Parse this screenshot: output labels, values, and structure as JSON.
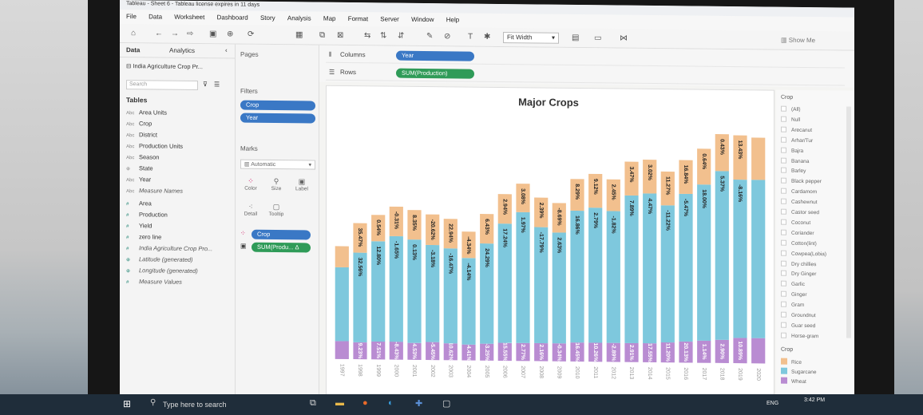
{
  "window": {
    "title": "Tableau - Sheet 6 - Tableau license expires in 11 days"
  },
  "menu": [
    "File",
    "Data",
    "Worksheet",
    "Dashboard",
    "Story",
    "Analysis",
    "Map",
    "Format",
    "Server",
    "Window",
    "Help"
  ],
  "toolbar": {
    "fit_label": "Fit Width",
    "show_me_label": "Show Me"
  },
  "data_pane": {
    "tab_data": "Data",
    "tab_analytics": "Analytics",
    "datasource": "India Agriculture Crop Pr...",
    "search_placeholder": "Search",
    "tables_header": "Tables",
    "fields": [
      {
        "type": "Abc",
        "name": "Area Units"
      },
      {
        "type": "Abc",
        "name": "Crop"
      },
      {
        "type": "Abc",
        "name": "District"
      },
      {
        "type": "Abc",
        "name": "Production Units"
      },
      {
        "type": "Abc",
        "name": "Season"
      },
      {
        "type": "globe",
        "name": "State"
      },
      {
        "type": "Abc",
        "name": "Year"
      },
      {
        "type": "Abc",
        "name": "Measure Names"
      },
      {
        "type": "#",
        "name": "Area"
      },
      {
        "type": "#",
        "name": "Production"
      },
      {
        "type": "#",
        "name": "Yield"
      },
      {
        "type": "#",
        "name": "zero line"
      },
      {
        "type": "#",
        "name": "India Agriculture Crop Pro..."
      },
      {
        "type": "globe",
        "name": "Latitude (generated)"
      },
      {
        "type": "globe",
        "name": "Longitude (generated)"
      },
      {
        "type": "#",
        "name": "Measure Values"
      }
    ]
  },
  "cards": {
    "pages": "Pages",
    "filters": "Filters",
    "filter_pills": [
      "Crop",
      "Year"
    ],
    "marks": "Marks",
    "mark_type": "Automatic",
    "mark_buttons": [
      "Color",
      "Size",
      "Label",
      "Detail",
      "Tooltip"
    ],
    "mark_pills": [
      "Crop",
      "SUM(Produ..."
    ]
  },
  "shelves": {
    "columns_label": "Columns",
    "columns_pill": "Year",
    "rows_label": "Rows",
    "rows_pill": "SUM(Production)"
  },
  "legend": {
    "title": "Crop",
    "filter_items": [
      "(All)",
      "Null",
      "Arecanut",
      "Arhar/Tur",
      "Bajra",
      "Banana",
      "Barley",
      "Black pepper",
      "Cardamom",
      "Cashewnut",
      "Castor seed",
      "Coconut",
      "Coriander",
      "Cotton(lint)",
      "Cowpea(Lobia)",
      "Dry chillies",
      "Dry Ginger",
      "Garlic",
      "Ginger",
      "Gram",
      "Groundnut",
      "Guar seed",
      "Horse-gram"
    ],
    "color_title": "Crop",
    "color_items": [
      {
        "name": "Rice",
        "color": "#f2c08e"
      },
      {
        "name": "Sugarcane",
        "color": "#7ec8dd"
      },
      {
        "name": "Wheat",
        "color": "#b98cd2"
      }
    ]
  },
  "chart_data": {
    "type": "bar",
    "title": "Major Crops",
    "stacked": true,
    "series_order": [
      "Wheat",
      "Sugarcane",
      "Rice"
    ],
    "colors": {
      "Rice": "#f2c08e",
      "Sugarcane": "#7ec8dd",
      "Wheat": "#b98cd2"
    },
    "categories": [
      "1997",
      "1998",
      "1999",
      "2000",
      "2001",
      "2002",
      "2003",
      "2004",
      "2005",
      "2006",
      "2007",
      "2008",
      "2009",
      "2010",
      "2011",
      "2012",
      "2013",
      "2014",
      "2015",
      "2016",
      "2017",
      "2018",
      "2019",
      "2020"
    ],
    "series": [
      {
        "name": "Wheat",
        "values": [
          17,
          16,
          17,
          17,
          16,
          17,
          16,
          15,
          16,
          17,
          17,
          17,
          17,
          18,
          18,
          18,
          18,
          18,
          19,
          20,
          21,
          22,
          24,
          24
        ],
        "labels": [
          "",
          "9.23%",
          "7.51%",
          "-8.43%",
          "4.53%",
          "-5.45%",
          "10.62%",
          "-4.41%",
          "-3.25%",
          "15.55%",
          "2.77%",
          "2.16%",
          "-0.34%",
          "16.45%",
          "10.26%",
          "-2.89%",
          "2.91%",
          "17.55%",
          "11.20%",
          "20.13%",
          "1.14%",
          "2.90%",
          "10.89%",
          ""
        ]
      },
      {
        "name": "Sugarcane",
        "values": [
          70,
          85,
          95,
          100,
          98,
          92,
          90,
          82,
          95,
          113,
          124,
          110,
          105,
          125,
          128,
          125,
          140,
          142,
          130,
          140,
          148,
          160,
          150,
          150
        ],
        "labels": [
          "",
          "32.56%",
          "12.80%",
          "-1.65%",
          "0.13%",
          "-3.18%",
          "-16.47%",
          "-4.14%",
          "24.29%",
          "17.24%",
          "1.97%",
          "-17.79%",
          "2.63%",
          "16.86%",
          "2.79%",
          "-1.82%",
          "7.89%",
          "4.47%",
          "-11.22%",
          "-5.47%",
          "18.00%",
          "5.37%",
          "-8.16%",
          ""
        ]
      },
      {
        "name": "Rice",
        "values": [
          20,
          28,
          25,
          28,
          28,
          29,
          28,
          25,
          28,
          28,
          27,
          28,
          28,
          30,
          32,
          30,
          32,
          32,
          32,
          32,
          34,
          35,
          42,
          40
        ],
        "labels": [
          "",
          "35.47%",
          "0.54%",
          "-0.31%",
          "8.35%",
          "-20.62%",
          "22.94%",
          "-4.34%",
          "6.43%",
          "2.94%",
          "3.08%",
          "2.39%",
          "-8.69%",
          "8.29%",
          "9.12%",
          "2.45%",
          "3.47%",
          "3.02%",
          "11.27%",
          "16.84%",
          "0.64%",
          "0.43%",
          "13.43%",
          ""
        ]
      }
    ]
  },
  "taskbar": {
    "search_placeholder": "Type here to search",
    "lang": "ENG",
    "time": "3:42 PM"
  }
}
